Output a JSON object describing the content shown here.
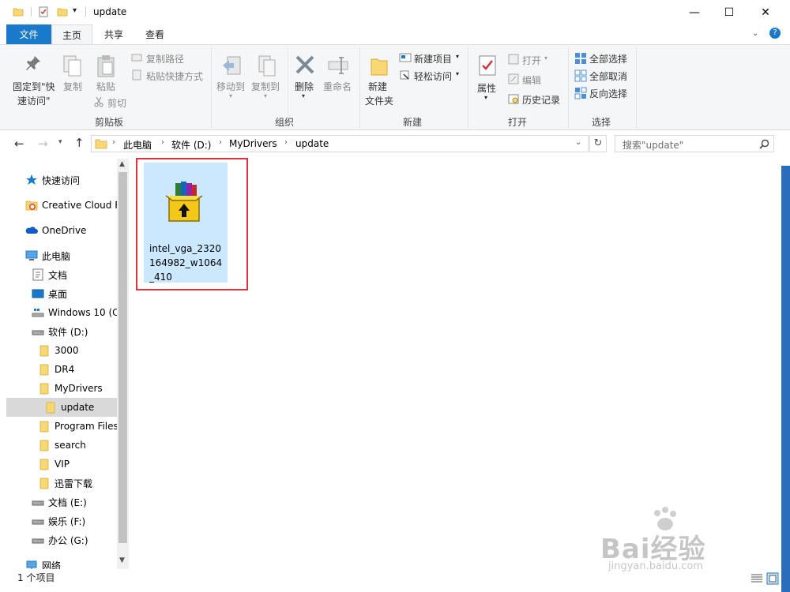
{
  "window": {
    "title": "update",
    "minimize": "—",
    "maximize": "☐",
    "close": "✕"
  },
  "tabs": [
    {
      "label": "文件"
    },
    {
      "label": "主页"
    },
    {
      "label": "共享"
    },
    {
      "label": "查看"
    }
  ],
  "ribbon": {
    "clipboard": {
      "label": "剪贴板",
      "pin_label_1": "固定到\"快",
      "pin_label_2": "速访问\"",
      "copy": "复制",
      "paste": "粘贴",
      "copy_path": "复制路径",
      "paste_shortcut": "粘贴快捷方式",
      "cut": "剪切"
    },
    "organize": {
      "label": "组织",
      "move_to": "移动到",
      "copy_to": "复制到",
      "delete": "删除",
      "rename": "重命名"
    },
    "new": {
      "label": "新建",
      "new_folder_1": "新建",
      "new_folder_2": "文件夹",
      "new_item": "新建项目",
      "easy_access": "轻松访问"
    },
    "open": {
      "label": "打开",
      "properties": "属性",
      "open": "打开",
      "edit": "编辑",
      "history": "历史记录"
    },
    "select": {
      "label": "选择",
      "select_all": "全部选择",
      "select_none": "全部取消",
      "invert": "反向选择"
    }
  },
  "address": {
    "crumbs": [
      "此电脑",
      "软件 (D:)",
      "MyDrivers",
      "update"
    ],
    "search_placeholder": "搜索\"update\""
  },
  "nav": {
    "items": [
      {
        "label": "快速访问",
        "icon": "star-icon"
      },
      {
        "label": "Creative Cloud F",
        "icon": "creative-cloud-icon"
      },
      {
        "label": "OneDrive",
        "icon": "onedrive-icon"
      },
      {
        "label": "此电脑",
        "icon": "computer-icon"
      },
      {
        "label": "文档",
        "icon": "document-icon"
      },
      {
        "label": "桌面",
        "icon": "desktop-icon"
      },
      {
        "label": "Windows 10 (C",
        "icon": "drive-icon"
      },
      {
        "label": "软件 (D:)",
        "icon": "drive-icon"
      },
      {
        "label": "3000",
        "icon": "folder-icon"
      },
      {
        "label": "DR4",
        "icon": "folder-icon"
      },
      {
        "label": "MyDrivers",
        "icon": "folder-icon"
      },
      {
        "label": "update",
        "icon": "folder-icon"
      },
      {
        "label": "Program Files",
        "icon": "folder-icon"
      },
      {
        "label": "search",
        "icon": "folder-icon"
      },
      {
        "label": "VIP",
        "icon": "folder-icon"
      },
      {
        "label": "迅雷下载",
        "icon": "folder-icon"
      },
      {
        "label": "文档 (E:)",
        "icon": "drive-icon"
      },
      {
        "label": "娱乐 (F:)",
        "icon": "drive-icon"
      },
      {
        "label": "办公 (G:)",
        "icon": "drive-icon"
      },
      {
        "label": "网络",
        "icon": "network-icon"
      }
    ]
  },
  "content": {
    "file": {
      "name": "intel_vga_2320164982_w1064_410",
      "icon": "winrar-archive-icon"
    }
  },
  "status": {
    "text": "1 个项目"
  },
  "watermark": {
    "brand": "Bai经验",
    "url": "jingyan.baidu.com"
  },
  "colors": {
    "file_tab": "#1979ca",
    "selection": "#cce8ff",
    "highlight": "#e0323c",
    "folder": "#f8d775"
  }
}
